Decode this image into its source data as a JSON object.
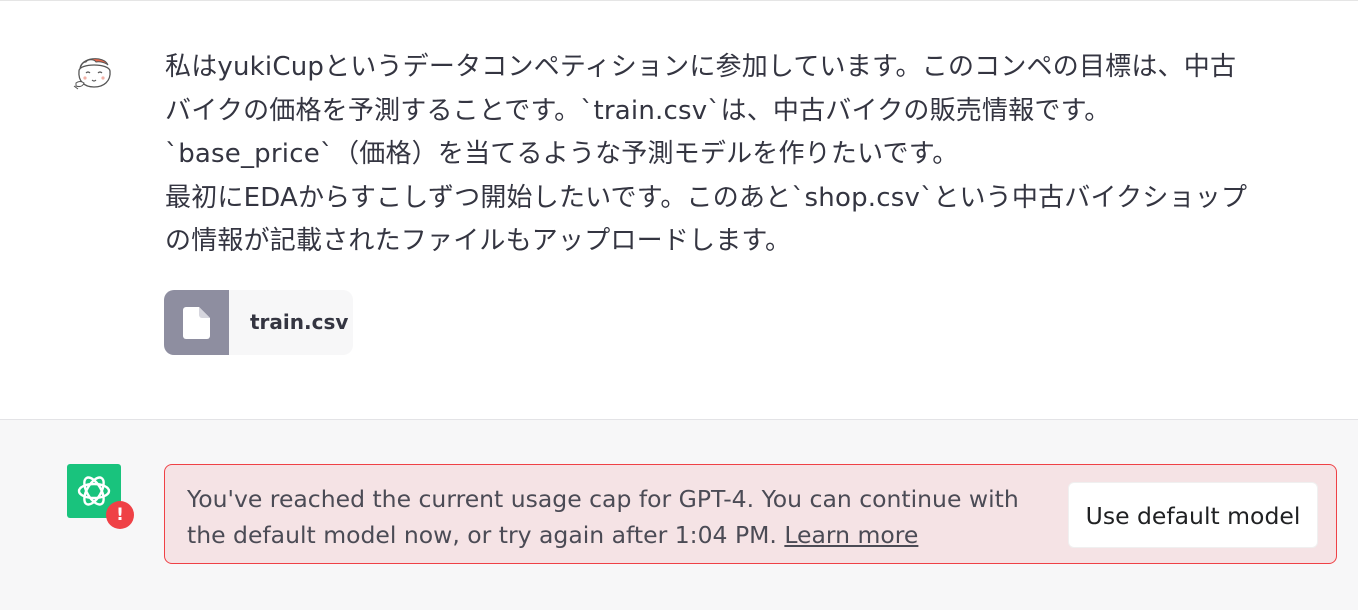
{
  "user_message": {
    "lines": [
      "私はyukiCupというデータコンペティションに参加しています。このコンペの目標は、中古",
      "バイクの価格を予測することです。`train.csv`は、中古バイクの販売情報です。",
      "`base_price`（価格）を当てるような予測モデルを作りたいです。",
      "最初にEDAからすこしずつ開始したいです。このあと`shop.csv`という中古バイクショップ",
      "の情報が記載されたファイルもアップロードします。"
    ],
    "attachment": {
      "file_name": "train.csv",
      "icon": "file-icon"
    },
    "avatar_icon": "user-avatar-icon"
  },
  "assistant_message": {
    "avatar_icon": "openai-logo-icon",
    "badge": "!",
    "error": {
      "text": "You've reached the current usage cap for GPT-4. You can continue with the default model now, or try again after 1:04 PM.",
      "link_text": "Learn more",
      "button_label": "Use default model"
    },
    "colors": {
      "error_border": "#ef4146",
      "error_background": "#f5e3e5",
      "avatar_background": "#19c37d",
      "row_background": "#f7f7f8"
    }
  }
}
